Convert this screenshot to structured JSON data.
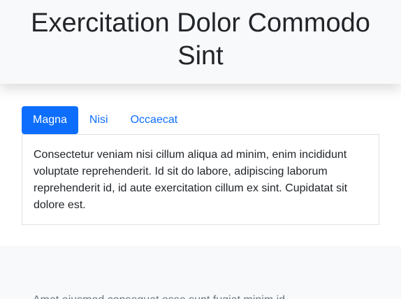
{
  "header": {
    "title_line1": "Exercitation Dolor Commodo",
    "title_line2": "Sint"
  },
  "tabs": [
    {
      "label": "Magna",
      "active": true
    },
    {
      "label": "Nisi",
      "active": false
    },
    {
      "label": "Occaecat",
      "active": false
    }
  ],
  "tab_panel": {
    "text": "Consectetur veniam nisi cillum aliqua ad minim, enim incididunt voluptate reprehenderit. Id sit do labore, adipiscing laborum reprehenderit id, id aute exercitation cillum ex sint. Cupidatat sit dolore est."
  },
  "section": {
    "text": "Amet eiusmod consequat esse sunt fugiat minim id"
  },
  "colors": {
    "accent": "#0d6efd",
    "header_bg": "#f8f9fa",
    "text": "#212529",
    "muted_text": "#6c757d"
  }
}
